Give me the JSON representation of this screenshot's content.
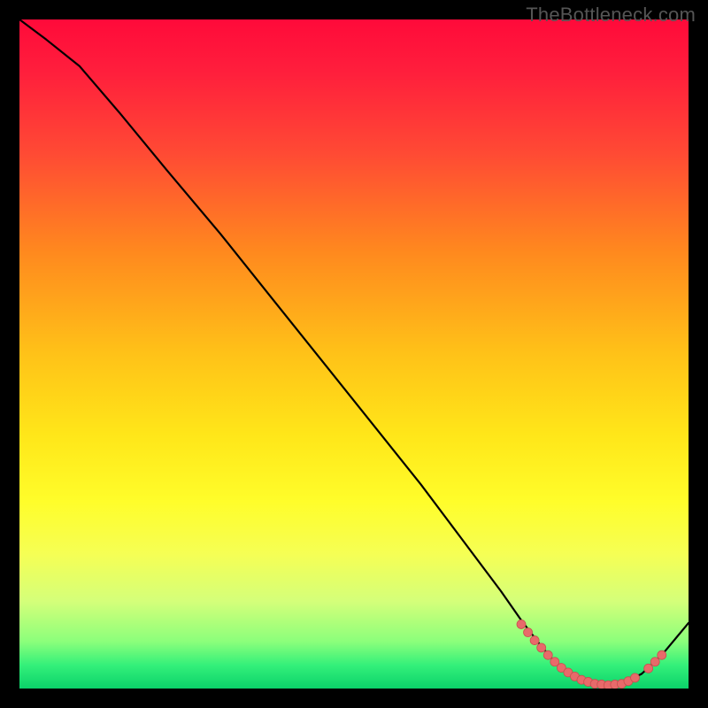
{
  "watermark": "TheBottleneck.com",
  "colors": {
    "line": "#000000",
    "marker_fill": "#e86a6a",
    "marker_stroke": "#c94f4f",
    "background_black": "#000000"
  },
  "chart_data": {
    "type": "line",
    "title": "",
    "xlabel": "",
    "ylabel": "",
    "xlim": [
      0,
      100
    ],
    "ylim": [
      0,
      100
    ],
    "x": [
      0,
      4,
      9,
      15,
      22,
      30,
      38,
      46,
      54,
      60,
      66,
      72,
      75,
      78,
      80,
      82,
      84,
      86,
      88,
      90,
      93,
      96,
      100
    ],
    "values": [
      100,
      97,
      93,
      86,
      77.5,
      68,
      58,
      48,
      38,
      30.5,
      22.5,
      14.5,
      10.2,
      6.3,
      4.0,
      2.4,
      1.3,
      0.7,
      0.5,
      0.7,
      2.2,
      5.0,
      9.8
    ],
    "markers": {
      "comment": "pink dotted marker points near valley; x in same 0-100 domain as line",
      "x": [
        75,
        76,
        77,
        78,
        79,
        80,
        81,
        82,
        83,
        84,
        85,
        86,
        87,
        88,
        89,
        90,
        91,
        92,
        94,
        95,
        96
      ],
      "y": [
        9.6,
        8.4,
        7.2,
        6.1,
        5.0,
        4.0,
        3.1,
        2.4,
        1.8,
        1.3,
        1.0,
        0.7,
        0.6,
        0.5,
        0.6,
        0.7,
        1.1,
        1.6,
        3.0,
        4.0,
        5.0
      ],
      "radius": 5
    }
  }
}
